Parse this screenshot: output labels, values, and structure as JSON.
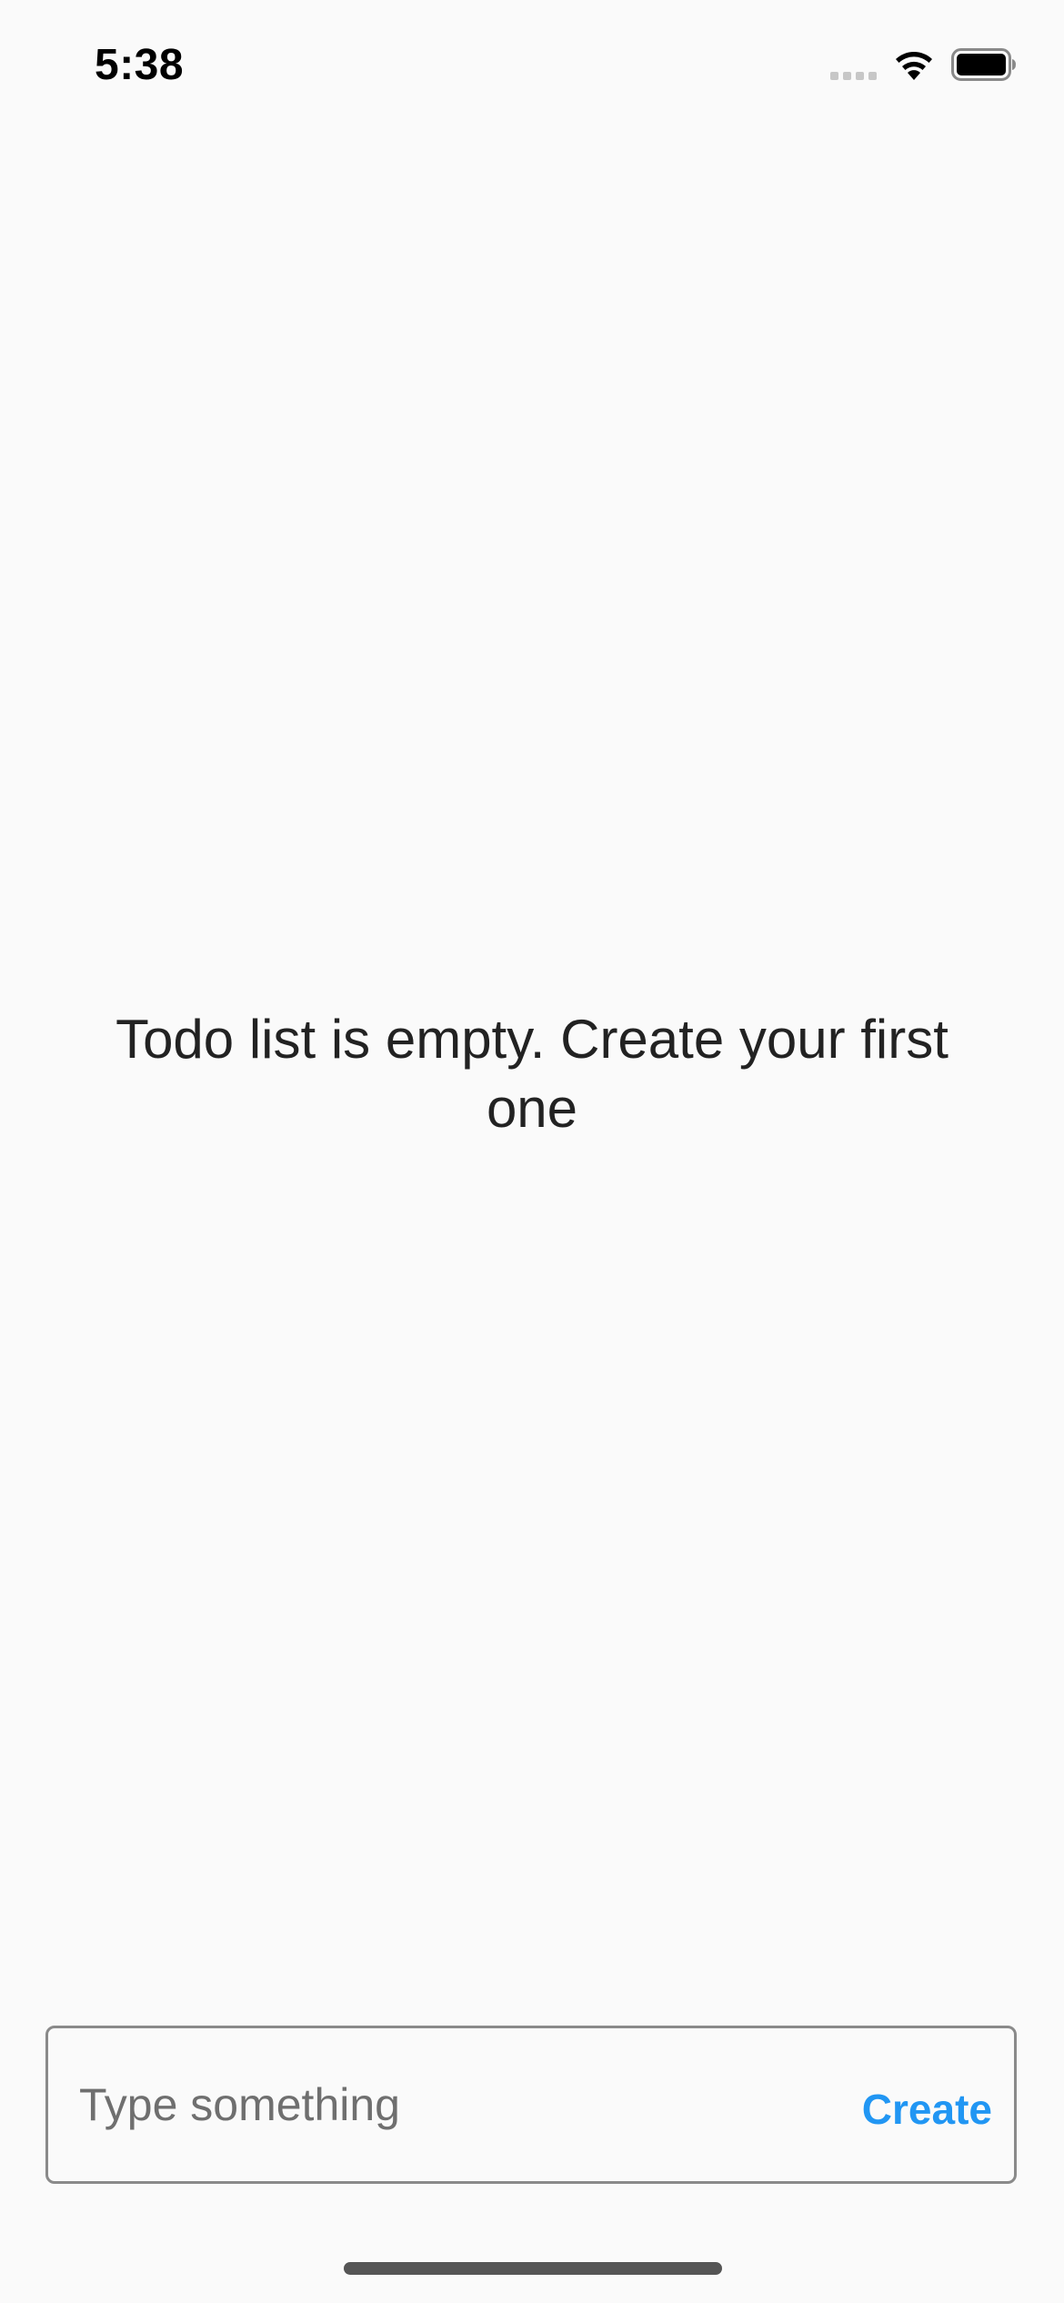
{
  "status_bar": {
    "time": "5:38",
    "icons": [
      "cellular-signal-icon",
      "wifi-icon",
      "battery-icon"
    ]
  },
  "main": {
    "empty_message": "Todo list is empty. Create your first one"
  },
  "composer": {
    "input_value": "",
    "input_placeholder": "Type something",
    "create_label": "Create"
  },
  "colors": {
    "background": "#fafafa",
    "accent": "#2196f3",
    "text": "#222222",
    "border": "#8a8a8a"
  }
}
